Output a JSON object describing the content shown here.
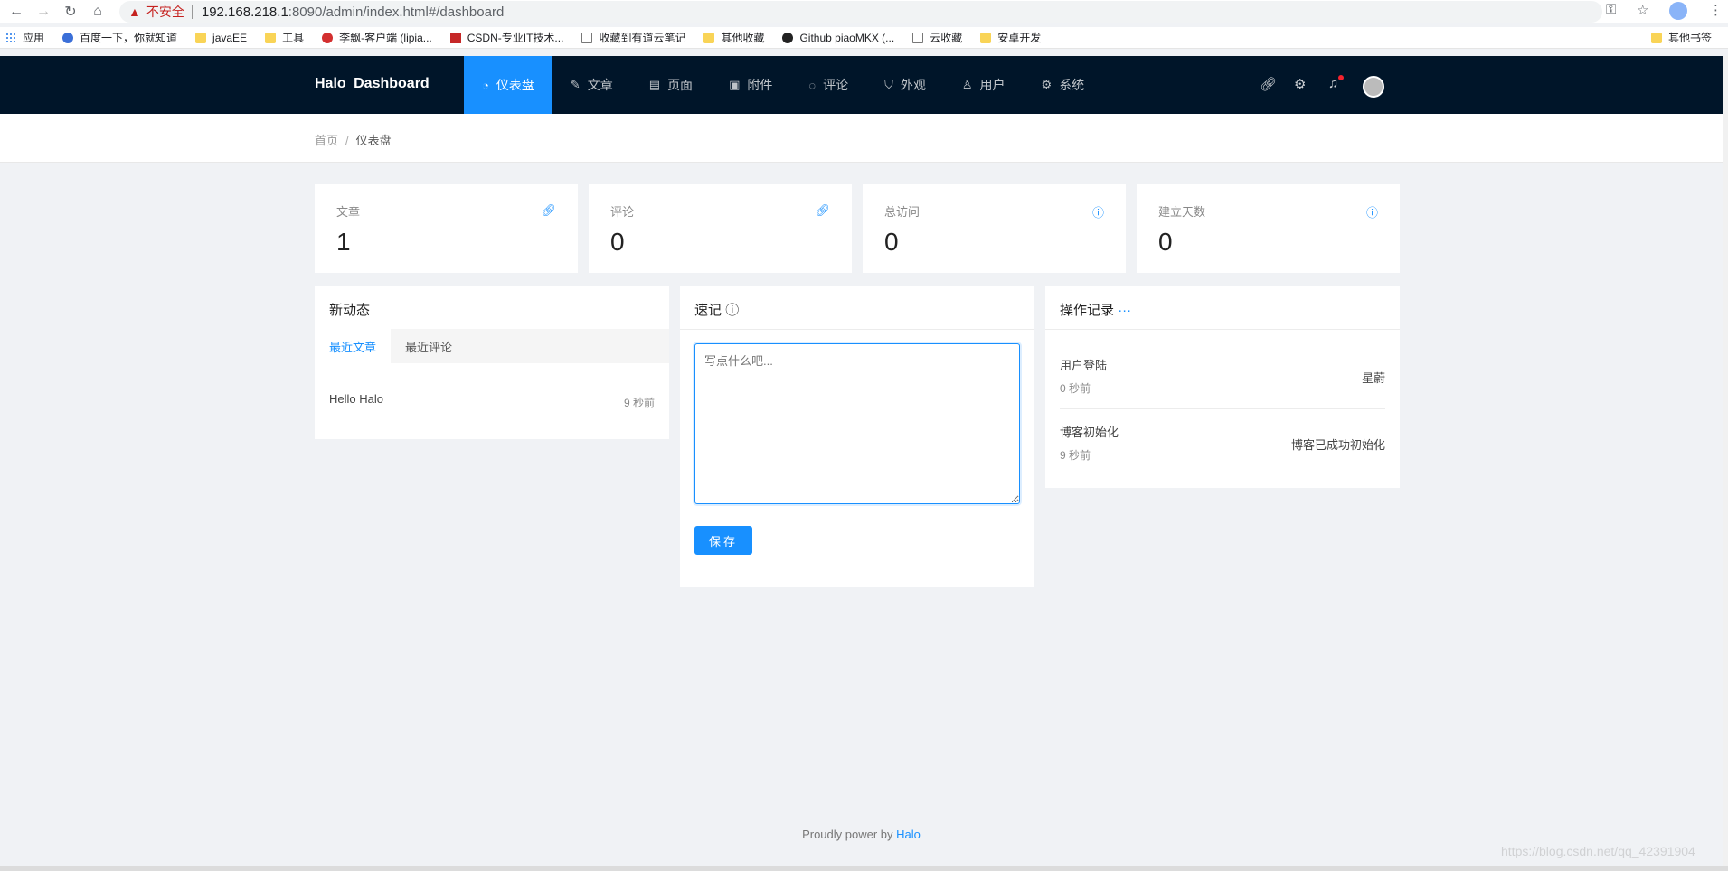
{
  "browser": {
    "back_icon": "arrow-left-icon",
    "warning_text": "不安全",
    "url_host": "192.168.218.1",
    "url_path": ":8090/admin/index.html#/dashboard",
    "bookmarks": [
      "应用",
      "百度一下，你就知道",
      "javaEE",
      "工具",
      "李飘-客户端 (lipia...",
      "CSDN-专业IT技术...",
      "收藏到有道云笔记",
      "其他收藏",
      "Github piaoMKX (...",
      "云收藏",
      "安卓开发"
    ],
    "other_bookmarks": "其他书签"
  },
  "header": {
    "brand": "Halo Dashboard",
    "menu": [
      {
        "label": "仪表盘",
        "icon": "dashboard-icon"
      },
      {
        "label": "文章",
        "icon": "edit-icon"
      },
      {
        "label": "页面",
        "icon": "book-icon"
      },
      {
        "label": "附件",
        "icon": "picture-icon"
      },
      {
        "label": "评论",
        "icon": "message-icon"
      },
      {
        "label": "外观",
        "icon": "skin-icon"
      },
      {
        "label": "用户",
        "icon": "user-icon"
      },
      {
        "label": "系统",
        "icon": "setting-icon"
      }
    ]
  },
  "breadcrumb": {
    "home": "首页",
    "current": "仪表盘"
  },
  "stats": [
    {
      "label": "文章",
      "value": "1",
      "icon": "link-icon"
    },
    {
      "label": "评论",
      "value": "0",
      "icon": "link-icon"
    },
    {
      "label": "总访问",
      "value": "0",
      "icon": "info-icon"
    },
    {
      "label": "建立天数",
      "value": "0",
      "icon": "info-icon"
    }
  ],
  "activity": {
    "title": "新动态",
    "tabs": [
      "最近文章",
      "最近评论"
    ],
    "items": [
      {
        "title": "Hello Halo",
        "time": "9 秒前"
      }
    ]
  },
  "memo": {
    "title": "速记",
    "placeholder": "写点什么吧...",
    "save_label": "保存"
  },
  "logs": {
    "title": "操作记录",
    "more": "···",
    "items": [
      {
        "type": "用户登陆",
        "time": "0 秒前",
        "content": "星蔚"
      },
      {
        "type": "博客初始化",
        "time": "9 秒前",
        "content": "博客已成功初始化"
      }
    ]
  },
  "footer": {
    "prefix": "Proudly power by",
    "link": "Halo"
  },
  "watermark": "https://blog.csdn.net/qq_42391904"
}
